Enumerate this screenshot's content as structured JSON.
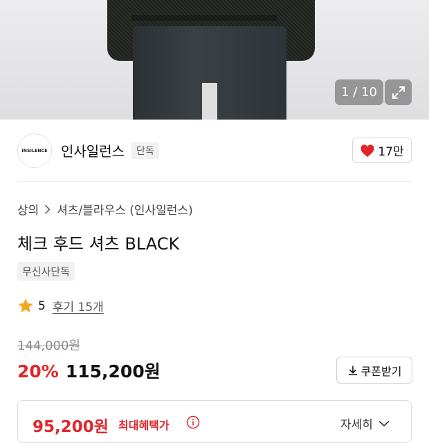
{
  "gallery": {
    "pager": "1 / 10",
    "expand_icon": "expand-icon"
  },
  "brand": {
    "logo_text": "INSILENCE",
    "name": "인사일런스",
    "tag": "단독",
    "likes": "17만",
    "like_icon": "heart-icon",
    "like_color": "#e0262b"
  },
  "breadcrumb": {
    "category": "상의",
    "separator_icon": "chevron-right-icon",
    "subcategory": "셔츠/블라우스 (인사일런스)"
  },
  "product": {
    "title": "체크 후드 셔츠 BLACK",
    "exclusive_tag": "무신사단독"
  },
  "rating": {
    "star_icon": "star-icon",
    "star_color": "#f5a623",
    "score": "5",
    "reviews": "후기 15개"
  },
  "price": {
    "original": "144,000원",
    "discount": "20%",
    "sale": "115,200원",
    "accent_color": "#e0262b"
  },
  "coupon": {
    "label": "쿠폰받기",
    "icon": "download-icon"
  },
  "benefit": {
    "price": "95,200원",
    "label": "최대혜택가",
    "info_icon": "info-icon",
    "detail": "자세히",
    "detail_icon": "chevron-down-icon"
  }
}
